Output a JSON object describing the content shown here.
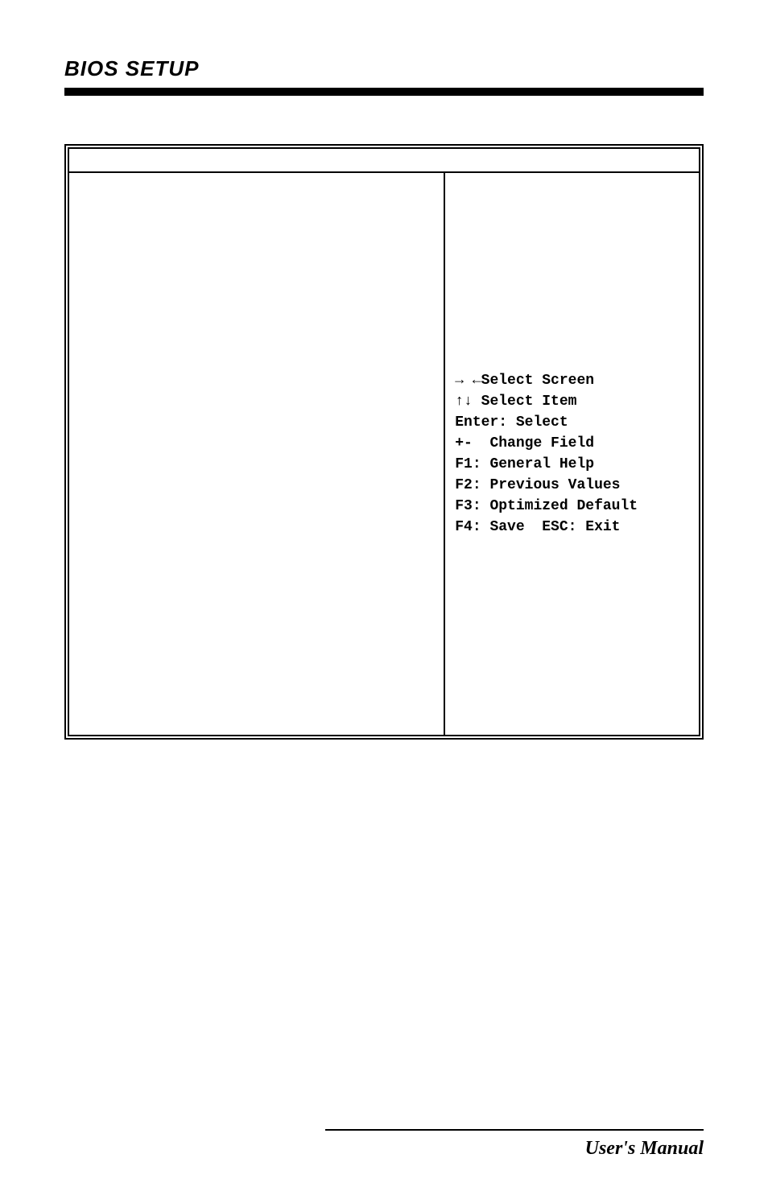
{
  "header": {
    "section_title": "BIOS SETUP"
  },
  "bios_help": {
    "line1": "→ ←Select Screen",
    "line2": "↑↓ Select Item",
    "line3": "Enter: Select",
    "line4": "+-  Change Field",
    "line5": "F1: General Help",
    "line6": "F2: Previous Values",
    "line7": "F3: Optimized Default",
    "line8": "F4: Save  ESC: Exit"
  },
  "footer": {
    "manual": "User's Manual"
  }
}
